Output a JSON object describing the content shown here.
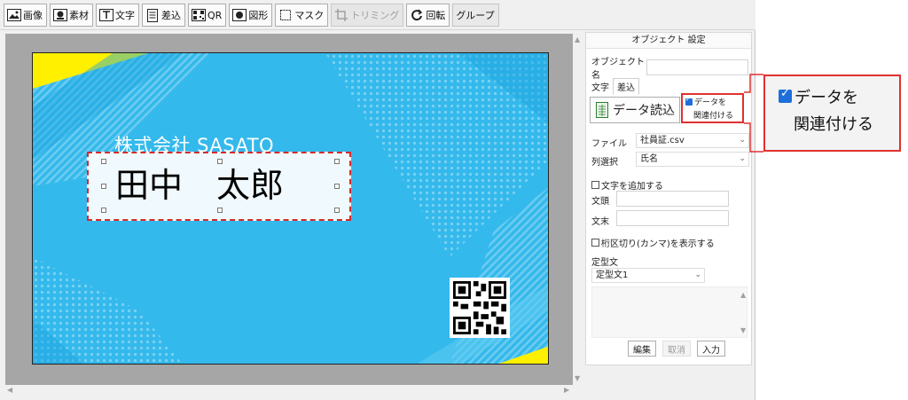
{
  "toolbar": {
    "buttons": [
      {
        "label": "画像",
        "icon": "image-icon"
      },
      {
        "label": "素材",
        "icon": "material-icon"
      },
      {
        "label": "文字",
        "icon": "text-icon"
      },
      {
        "label": "差込",
        "icon": "merge-icon"
      },
      {
        "label": "QR",
        "icon": "qr-icon"
      },
      {
        "label": "図形",
        "icon": "shape-icon"
      },
      {
        "label": "マスク",
        "icon": "mask-icon"
      },
      {
        "label": "トリミング",
        "icon": "crop-icon"
      },
      {
        "label": "回転",
        "icon": "rotate-icon"
      },
      {
        "label": "グループ",
        "icon": ""
      }
    ]
  },
  "card": {
    "company": "株式会社 SASATO",
    "name": "田中　太郎"
  },
  "panel": {
    "title": "オブジェクト 設定",
    "object_name_label": "オブジェクト名",
    "object_name_value": "",
    "tabs": [
      "文字",
      "差込"
    ],
    "load_button": "データ読込",
    "link_checkbox": {
      "line1": "データを",
      "line2": "関連付ける",
      "checked": true
    },
    "file_label": "ファイル",
    "file_value": "社員証.csv",
    "column_label": "列選択",
    "column_value": "氏名",
    "add_text_label": "文字を追加する",
    "prefix_label": "文頭",
    "prefix_value": "",
    "suffix_label": "文末",
    "suffix_value": "",
    "comma_label": "桁区切り(カンマ)を表示する",
    "fixed_text_label": "定型文",
    "fixed_text_value": "定型文1",
    "buttons": {
      "edit": "編集",
      "cancel": "取消",
      "input": "入力"
    }
  },
  "callout": {
    "line1": "データを",
    "line2": "関連付ける"
  },
  "colors": {
    "card_bg": "#34b9ec",
    "accent_yellow": "#fff000",
    "highlight_red": "#e03030",
    "checkbox_blue": "#1e6fd9"
  }
}
